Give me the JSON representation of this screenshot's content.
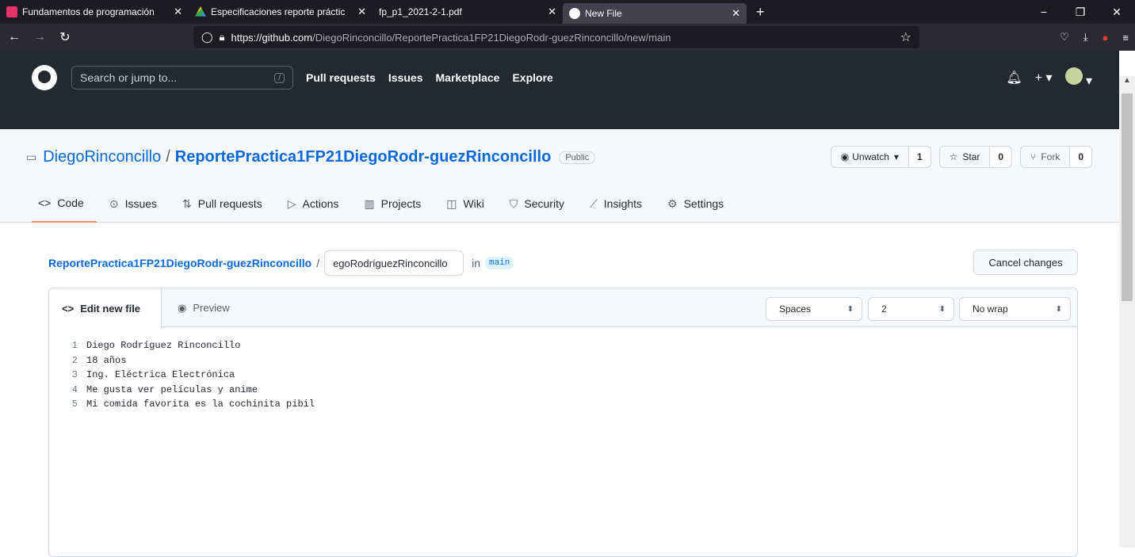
{
  "browser": {
    "tabs": [
      {
        "label": "Fundamentos de programación",
        "favicon_color": "#e5336b",
        "icon": "classroom-icon"
      },
      {
        "label": "Especificaciones reporte práctic",
        "favicon_color": "#fbbc04",
        "icon": "drive-icon"
      },
      {
        "label": "fp_p1_2021-2-1.pdf",
        "favicon_color": "",
        "icon": "pdf-icon"
      },
      {
        "label": "New File",
        "favicon_color": "#ffffff",
        "icon": "github-icon"
      }
    ],
    "url_host": "https://github.com",
    "url_path": "/DiegoRinconcillo/ReportePractica1FP21DiegoRodr-guezRinconcillo/new/main"
  },
  "header": {
    "search_placeholder": "Search or jump to...",
    "search_shortcut": "/",
    "nav": [
      "Pull requests",
      "Issues",
      "Marketplace",
      "Explore"
    ]
  },
  "repo": {
    "owner": "DiegoRinconcillo",
    "name": "ReportePractica1FP21DiegoRodr-guezRinconcillo",
    "visibility": "Public",
    "watch_label": "Unwatch",
    "watch_count": "1",
    "star_label": "Star",
    "star_count": "0",
    "fork_label": "Fork",
    "fork_count": "0",
    "tabs": [
      {
        "label": "Code",
        "icon": "code-icon"
      },
      {
        "label": "Issues",
        "icon": "issue-icon"
      },
      {
        "label": "Pull requests",
        "icon": "pull-request-icon"
      },
      {
        "label": "Actions",
        "icon": "play-icon"
      },
      {
        "label": "Projects",
        "icon": "project-icon"
      },
      {
        "label": "Wiki",
        "icon": "book-icon"
      },
      {
        "label": "Security",
        "icon": "shield-icon"
      },
      {
        "label": "Insights",
        "icon": "graph-icon"
      },
      {
        "label": "Settings",
        "icon": "gear-icon"
      }
    ]
  },
  "editor": {
    "breadcrumb_repo": "ReportePractica1FP21DiegoRodr-guezRinconcillo",
    "filename_value": "egoRodríguezRinconcillo",
    "in_label": "in",
    "branch": "main",
    "cancel_label": "Cancel changes",
    "edit_tab": "Edit new file",
    "preview_tab": "Preview",
    "indent_mode": "Spaces",
    "indent_size": "2",
    "wrap_mode": "No wrap",
    "lines": [
      {
        "n": "1",
        "text": "Diego Rodríguez Rinconcillo"
      },
      {
        "n": "2",
        "text": "18 años"
      },
      {
        "n": "3",
        "text": "Ing. Eléctrica Electrónica"
      },
      {
        "n": "4",
        "text": "Me gusta ver películas y anime"
      },
      {
        "n": "5",
        "text": "Mi comida favorita es la cochinita pibil"
      }
    ]
  }
}
